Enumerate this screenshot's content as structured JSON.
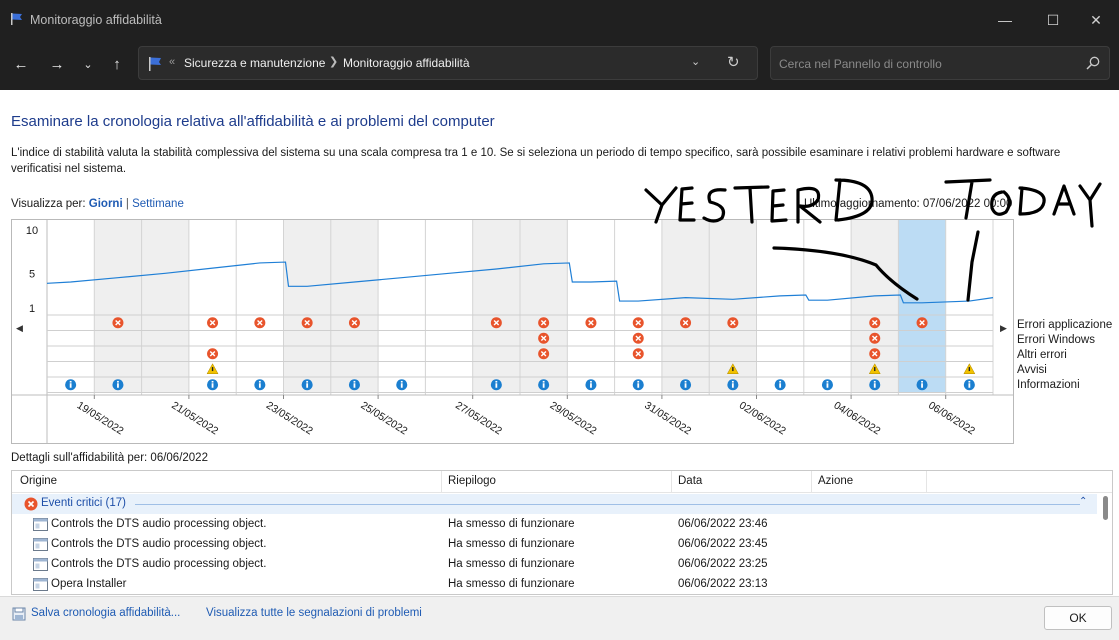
{
  "window": {
    "title": "Monitoraggio affidabilità"
  },
  "nav": {
    "breadcrumb": [
      "Sicurezza e manutenzione",
      "Monitoraggio affidabilità"
    ],
    "search_placeholder": "Cerca nel Pannello di controllo"
  },
  "content": {
    "heading": "Esaminare la cronologia relativa all'affidabilità e ai problemi del computer",
    "description": "L'indice di stabilità valuta la stabilità complessiva del sistema su una scala compresa tra 1 e 10. Se si seleziona un periodo di tempo specifico, sarà possibile esaminare i relativi problemi hardware e software verificatisi nel sistema.",
    "view_by_label": "Visualizza per:",
    "view_days": "Giorni",
    "view_weeks": "Settimane",
    "last_update": "Ultimo aggiornamento: 07/06/2022 00:00"
  },
  "chart_data": {
    "type": "line",
    "y_ticks": [
      "10",
      "5",
      "1"
    ],
    "ylim": [
      1,
      10
    ],
    "date_labels": [
      "19/05/2022",
      "21/05/2022",
      "23/05/2022",
      "25/05/2022",
      "27/05/2022",
      "29/05/2022",
      "31/05/2022",
      "02/06/2022",
      "04/06/2022",
      "06/06/2022"
    ],
    "selected_day_index": 18,
    "stability_index": [
      4.0,
      4.5,
      5.0,
      5.6,
      6.2,
      3.5,
      4.0,
      4.5,
      5.0,
      5.5,
      6.1,
      4.0,
      1.8,
      2.2,
      2.0,
      2.4,
      1.9,
      2.4,
      1.6,
      1.8
    ],
    "row_labels": [
      "Errori applicazione",
      "Errori Windows",
      "Altri errori",
      "Avvisi",
      "Informazioni"
    ],
    "rows": {
      "errori_applicazione": [
        0,
        1,
        0,
        1,
        1,
        1,
        1,
        0,
        0,
        1,
        1,
        1,
        1,
        1,
        1,
        0,
        0,
        1,
        1,
        0
      ],
      "errori_windows": [
        0,
        0,
        0,
        0,
        0,
        0,
        0,
        0,
        0,
        0,
        1,
        0,
        1,
        0,
        0,
        0,
        0,
        1,
        0,
        0
      ],
      "altri_errori": [
        0,
        0,
        0,
        1,
        0,
        0,
        0,
        0,
        0,
        0,
        1,
        0,
        1,
        0,
        0,
        0,
        0,
        1,
        0,
        0
      ],
      "avvisi": [
        0,
        0,
        0,
        1,
        0,
        0,
        0,
        0,
        0,
        0,
        0,
        0,
        0,
        0,
        1,
        0,
        0,
        1,
        0,
        1
      ],
      "informazioni": [
        1,
        1,
        0,
        1,
        1,
        1,
        1,
        1,
        0,
        1,
        1,
        1,
        1,
        1,
        1,
        1,
        1,
        1,
        1,
        1
      ]
    }
  },
  "details": {
    "title": "Dettagli sull'affidabilità per: 06/06/2022",
    "columns": [
      "Origine",
      "Riepilogo",
      "Data",
      "Azione"
    ],
    "group_label": "Eventi critici (17)",
    "rows": [
      {
        "source": "Controls the DTS audio processing object.",
        "summary": "Ha smesso di funzionare",
        "date": "06/06/2022 23:46"
      },
      {
        "source": "Controls the DTS audio processing object.",
        "summary": "Ha smesso di funzionare",
        "date": "06/06/2022 23:45"
      },
      {
        "source": "Controls the DTS audio processing object.",
        "summary": "Ha smesso di funzionare",
        "date": "06/06/2022 23:25"
      },
      {
        "source": "Opera Installer",
        "summary": "Ha smesso di funzionare",
        "date": "06/06/2022 23:13"
      }
    ]
  },
  "footer": {
    "save_link": "Salva cronologia affidabilità...",
    "view_all_link": "Visualizza tutte le segnalazioni di problemi",
    "ok_label": "OK"
  },
  "colors": {
    "line": "#1f7fd6",
    "selected": "#bcdcf4",
    "error": "#e8542c",
    "info": "#1b7fd0",
    "warning": "#f2c200"
  },
  "annotations": {
    "left_text": "YESTERD",
    "right_text": "TODAY"
  }
}
